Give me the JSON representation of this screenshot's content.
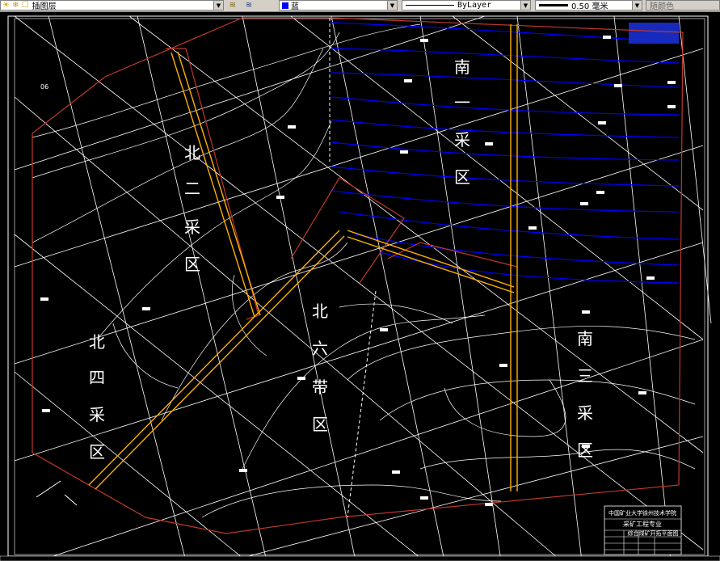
{
  "toolbar": {
    "layer_name": "插图层",
    "color_name": "蓝",
    "color_hex": "#0000ff",
    "linetype": "ByLayer",
    "lineweight": "0.50 毫米",
    "plotstyle": "随颜色"
  },
  "drawing": {
    "regions": [
      {
        "id": "north-2",
        "chars": [
          "北",
          "二",
          "采",
          "区"
        ]
      },
      {
        "id": "south-1",
        "chars": [
          "南",
          "一",
          "采",
          "区"
        ]
      },
      {
        "id": "north-6",
        "chars": [
          "北",
          "六",
          "带",
          "区"
        ]
      },
      {
        "id": "north-4",
        "chars": [
          "北",
          "四",
          "采",
          "区"
        ]
      },
      {
        "id": "south-3",
        "chars": [
          "南",
          "三",
          "采",
          "区"
        ]
      }
    ],
    "corner_label": "06",
    "title_block": {
      "line1": "中国矿业大学徐州技术学院",
      "line2": "采矿工程专业",
      "line3": "综合煤矿开拓平面图"
    },
    "colors": {
      "background": "#000000",
      "contour": "#ffffff",
      "seam_contour": "#0000ff",
      "boundary": "#c0392b",
      "roadway": "#ffb000"
    }
  }
}
